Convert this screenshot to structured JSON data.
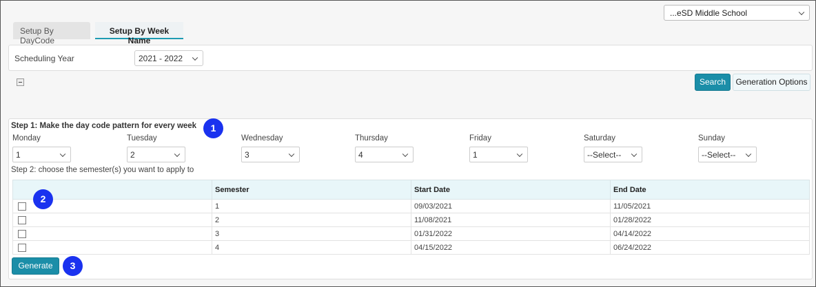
{
  "school_select": {
    "value": "...eSD Middle School"
  },
  "tabs": [
    {
      "label": "Setup By DayCode"
    },
    {
      "label": "Setup By Week Name"
    }
  ],
  "scheduling_year": {
    "label": "Scheduling Year",
    "value": "2021 - 2022"
  },
  "toolbar": {
    "search_label": "Search",
    "generation_options_label": "Generation Options"
  },
  "step1": {
    "title": "Step 1: Make the day code pattern for every week",
    "days": [
      {
        "label": "Monday",
        "value": "1"
      },
      {
        "label": "Tuesday",
        "value": "2"
      },
      {
        "label": "Wednesday",
        "value": "3"
      },
      {
        "label": "Thursday",
        "value": "4"
      },
      {
        "label": "Friday",
        "value": "1"
      },
      {
        "label": "Saturday",
        "value": "--Select--"
      },
      {
        "label": "Sunday",
        "value": "--Select--"
      }
    ]
  },
  "step2": {
    "title": "Step 2: choose the semester(s) you want to apply to",
    "columns": [
      "",
      "Semester",
      "Start Date",
      "End Date"
    ],
    "rows": [
      {
        "semester": "1",
        "start": "09/03/2021",
        "end": "11/05/2021"
      },
      {
        "semester": "2",
        "start": "11/08/2021",
        "end": "01/28/2022"
      },
      {
        "semester": "3",
        "start": "01/31/2022",
        "end": "04/14/2022"
      },
      {
        "semester": "4",
        "start": "04/15/2022",
        "end": "06/24/2022"
      }
    ]
  },
  "generate_label": "Generate",
  "badges": [
    "1",
    "2",
    "3"
  ],
  "colors": {
    "accent": "#1b8ea8",
    "badge": "#1a32ef",
    "header_bg": "#e8f6f9"
  }
}
